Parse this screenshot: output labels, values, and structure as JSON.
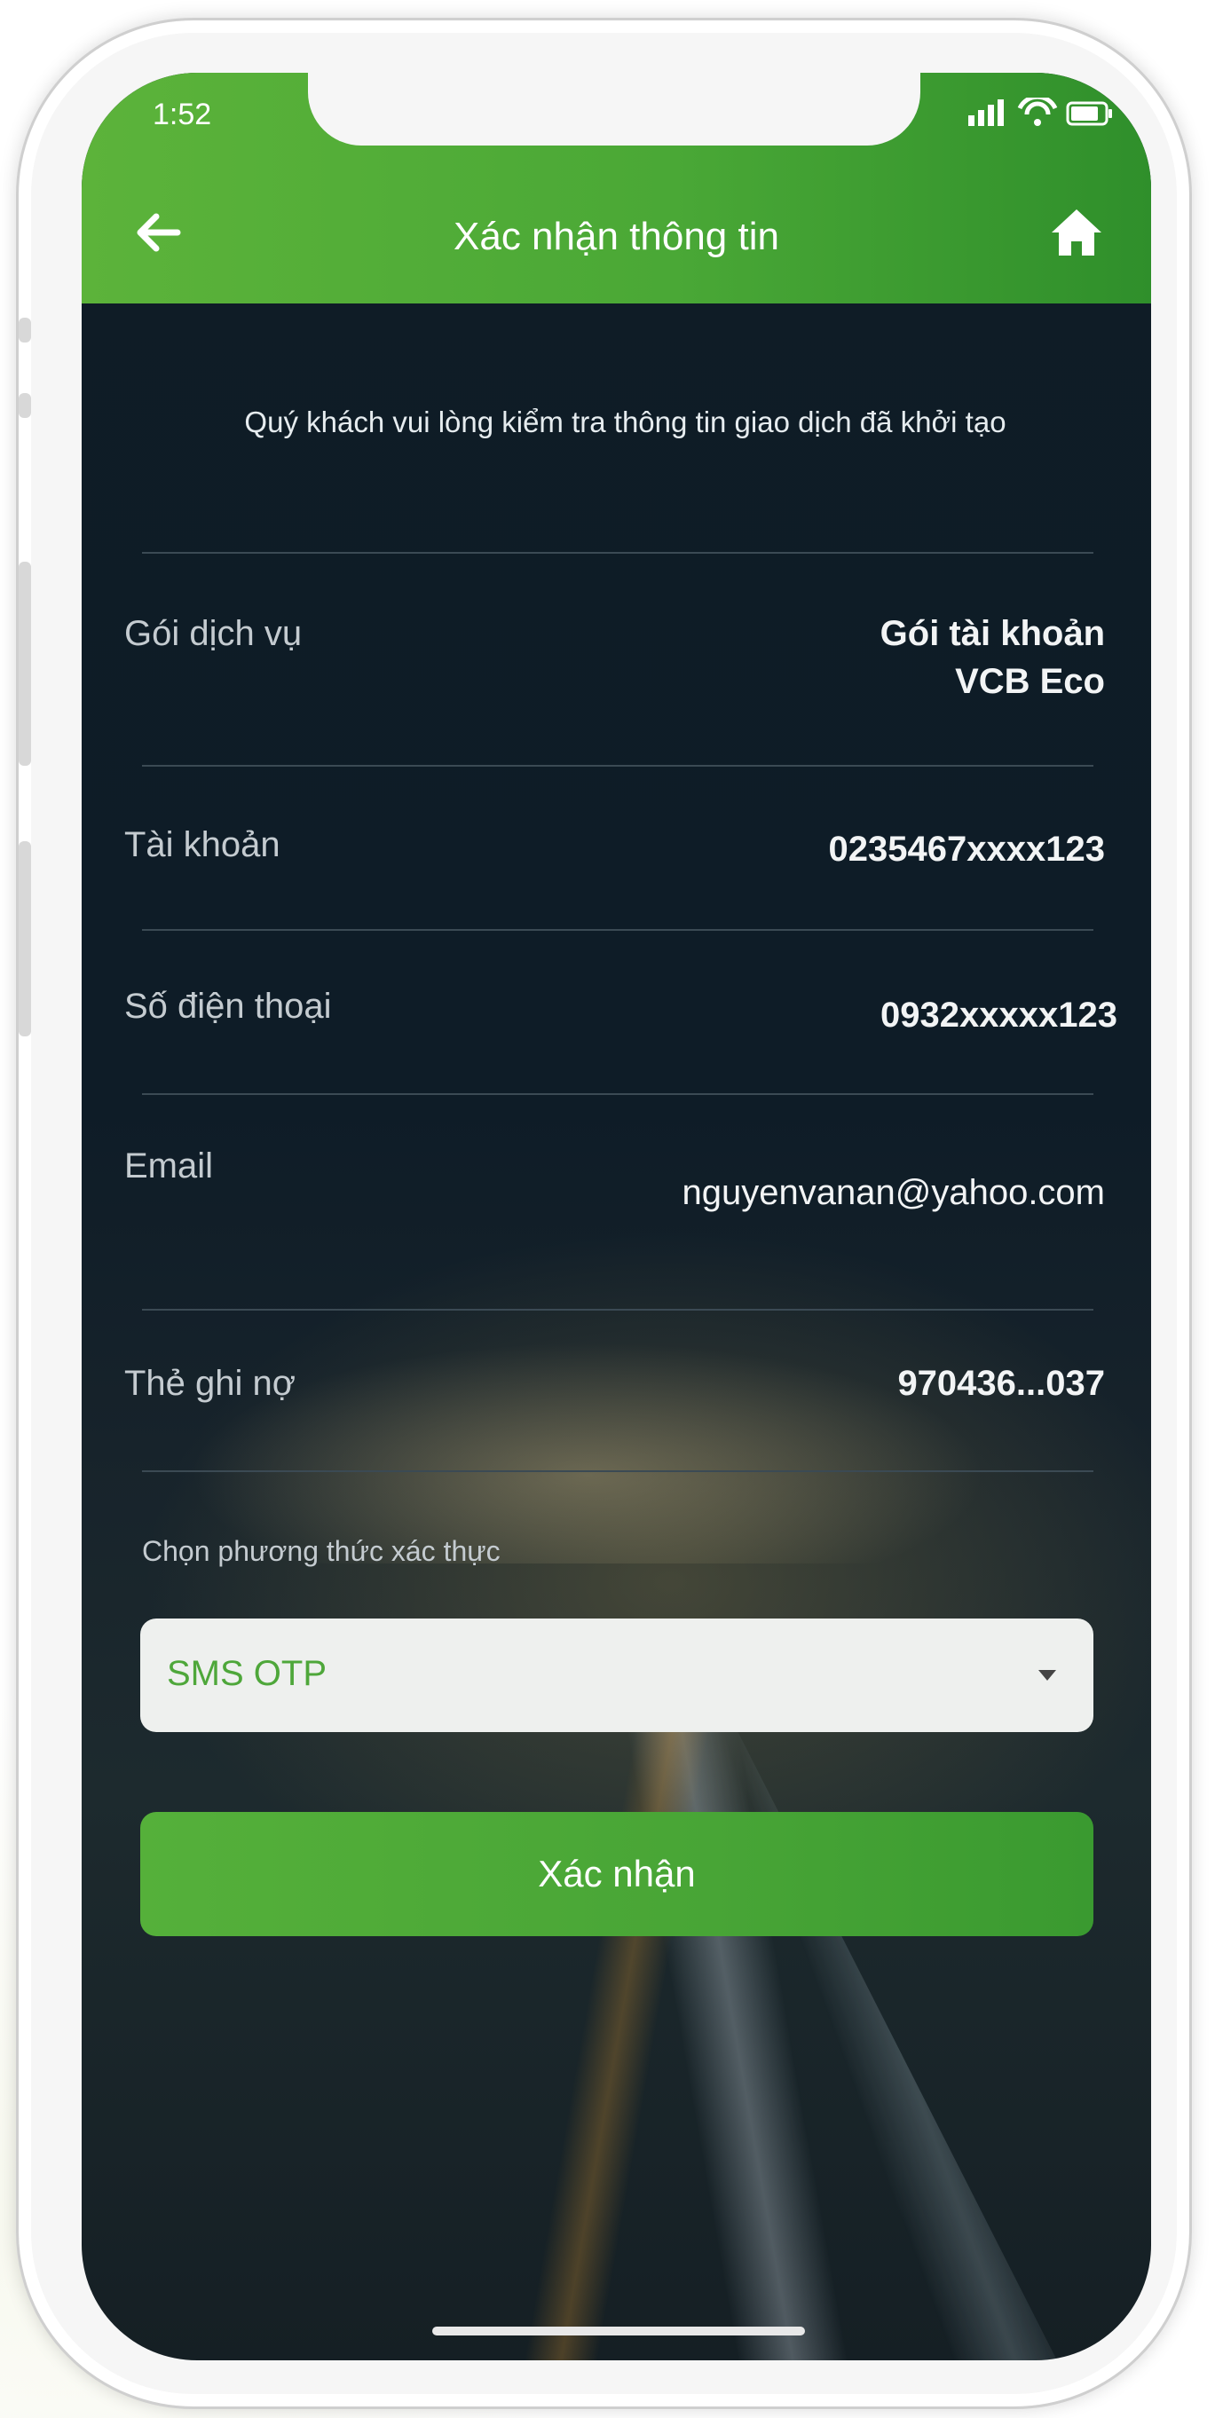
{
  "status_bar": {
    "time": "1:52"
  },
  "nav": {
    "title": "Xác nhận thông tin"
  },
  "intro": "Quý khách vui lòng kiểm tra thông tin giao dịch đã khởi tạo",
  "details": [
    {
      "label": "Gói dịch vụ",
      "value_line1": "Gói tài khoản",
      "value_line2": "VCB Eco"
    },
    {
      "label": "Tài khoản",
      "value": "0235467xxxx123"
    },
    {
      "label": "Số điện thoại",
      "value": "0932xxxxx123"
    },
    {
      "label": "Email",
      "value": "nguyenvanan@yahoo.com"
    },
    {
      "label": "Thẻ ghi nợ",
      "value": "970436...037"
    }
  ],
  "auth": {
    "label": "Chọn phương thức xác thực",
    "selected": "SMS OTP"
  },
  "confirm_label": "Xác nhận",
  "colors": {
    "brand_green": "#4aa836",
    "background_dark": "#0f1c26"
  },
  "icons": {
    "back": "arrow-left-icon",
    "home": "home-icon",
    "dropdown": "caret-down-icon"
  }
}
